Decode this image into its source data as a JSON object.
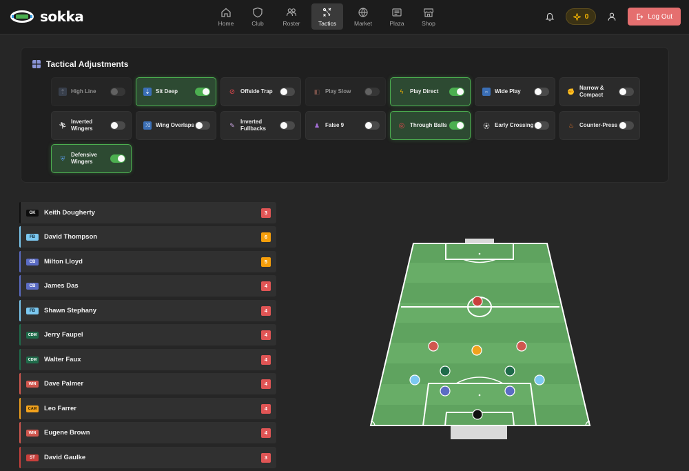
{
  "brand": {
    "name": "sokka"
  },
  "nav": [
    {
      "label": "Home",
      "icon": "home-icon",
      "active": false
    },
    {
      "label": "Club",
      "icon": "shield-icon",
      "active": false
    },
    {
      "label": "Roster",
      "icon": "users-icon",
      "active": false
    },
    {
      "label": "Tactics",
      "icon": "tactics-icon",
      "active": true
    },
    {
      "label": "Market",
      "icon": "globe-icon",
      "active": false
    },
    {
      "label": "Plaza",
      "icon": "newspaper-icon",
      "active": false
    },
    {
      "label": "Shop",
      "icon": "store-icon",
      "active": false
    }
  ],
  "header": {
    "coins": "0",
    "logout_label": "Log Out"
  },
  "tactics": {
    "title": "Tactical Adjustments",
    "items": [
      {
        "label": "High Line",
        "on": false,
        "disabled": true,
        "icon": "high-line-icon"
      },
      {
        "label": "Sit Deep",
        "on": true,
        "disabled": false,
        "icon": "sit-deep-icon"
      },
      {
        "label": "Offside Trap",
        "on": false,
        "disabled": false,
        "icon": "offside-trap-icon"
      },
      {
        "label": "Play Slow",
        "on": false,
        "disabled": true,
        "icon": "play-slow-icon"
      },
      {
        "label": "Play Direct",
        "on": true,
        "disabled": false,
        "icon": "lightning-icon"
      },
      {
        "label": "Wide Play",
        "on": false,
        "disabled": false,
        "icon": "wide-play-icon"
      },
      {
        "label": "Narrow & Compact",
        "on": false,
        "disabled": false,
        "icon": "handshake-icon"
      },
      {
        "label": "Inverted Wingers",
        "on": false,
        "disabled": false,
        "icon": "runner-icon"
      },
      {
        "label": "Wing Overlaps",
        "on": false,
        "disabled": false,
        "icon": "shuffle-icon"
      },
      {
        "label": "Inverted Fullbacks",
        "on": false,
        "disabled": false,
        "icon": "syringe-icon"
      },
      {
        "label": "False 9",
        "on": false,
        "disabled": false,
        "icon": "person-icon"
      },
      {
        "label": "Through Balls",
        "on": true,
        "disabled": false,
        "icon": "target-icon"
      },
      {
        "label": "Early Crossing",
        "on": false,
        "disabled": false,
        "icon": "kick-icon"
      },
      {
        "label": "Counter-Press",
        "on": false,
        "disabled": false,
        "icon": "fire-icon"
      },
      {
        "label": "Defensive Wingers",
        "on": true,
        "disabled": false,
        "icon": "shield-small-icon"
      }
    ]
  },
  "players": [
    {
      "position": "GK",
      "name": "Keith Dougherty",
      "rating": "3",
      "color": "#111111",
      "rating_color": "#e05555"
    },
    {
      "position": "FB",
      "name": "David Thompson",
      "rating": "6",
      "color": "#7cc8f0",
      "rating_color": "#f59e0b"
    },
    {
      "position": "CB",
      "name": "Milton Lloyd",
      "rating": "5",
      "color": "#5b6cc4",
      "rating_color": "#f59e0b"
    },
    {
      "position": "CB",
      "name": "James Das",
      "rating": "4",
      "color": "#5b6cc4",
      "rating_color": "#e05555"
    },
    {
      "position": "FB",
      "name": "Shawn Stephany",
      "rating": "4",
      "color": "#7cc8f0",
      "rating_color": "#e05555"
    },
    {
      "position": "CDM",
      "name": "Jerry Faupel",
      "rating": "4",
      "color": "#1f6b4a",
      "rating_color": "#e05555"
    },
    {
      "position": "CDM",
      "name": "Walter Faux",
      "rating": "4",
      "color": "#1f6b4a",
      "rating_color": "#e05555"
    },
    {
      "position": "WIN",
      "name": "Dave Palmer",
      "rating": "4",
      "color": "#d0574f",
      "rating_color": "#e05555"
    },
    {
      "position": "CAM",
      "name": "Leo Farrer",
      "rating": "4",
      "color": "#f2a21d",
      "rating_color": "#e05555"
    },
    {
      "position": "WIN",
      "name": "Eugene Brown",
      "rating": "4",
      "color": "#d0574f",
      "rating_color": "#e05555"
    },
    {
      "position": "ST",
      "name": "David Gaulke",
      "rating": "3",
      "color": "#c9403c",
      "rating_color": "#e05555"
    }
  ],
  "formation_colors": {
    "GK": "#111111",
    "FB": "#7cc8f0",
    "CB": "#5b6cc4",
    "CDM": "#1f6b4a",
    "WIN": "#d0574f",
    "CAM": "#f2a21d",
    "ST": "#c9403c"
  }
}
